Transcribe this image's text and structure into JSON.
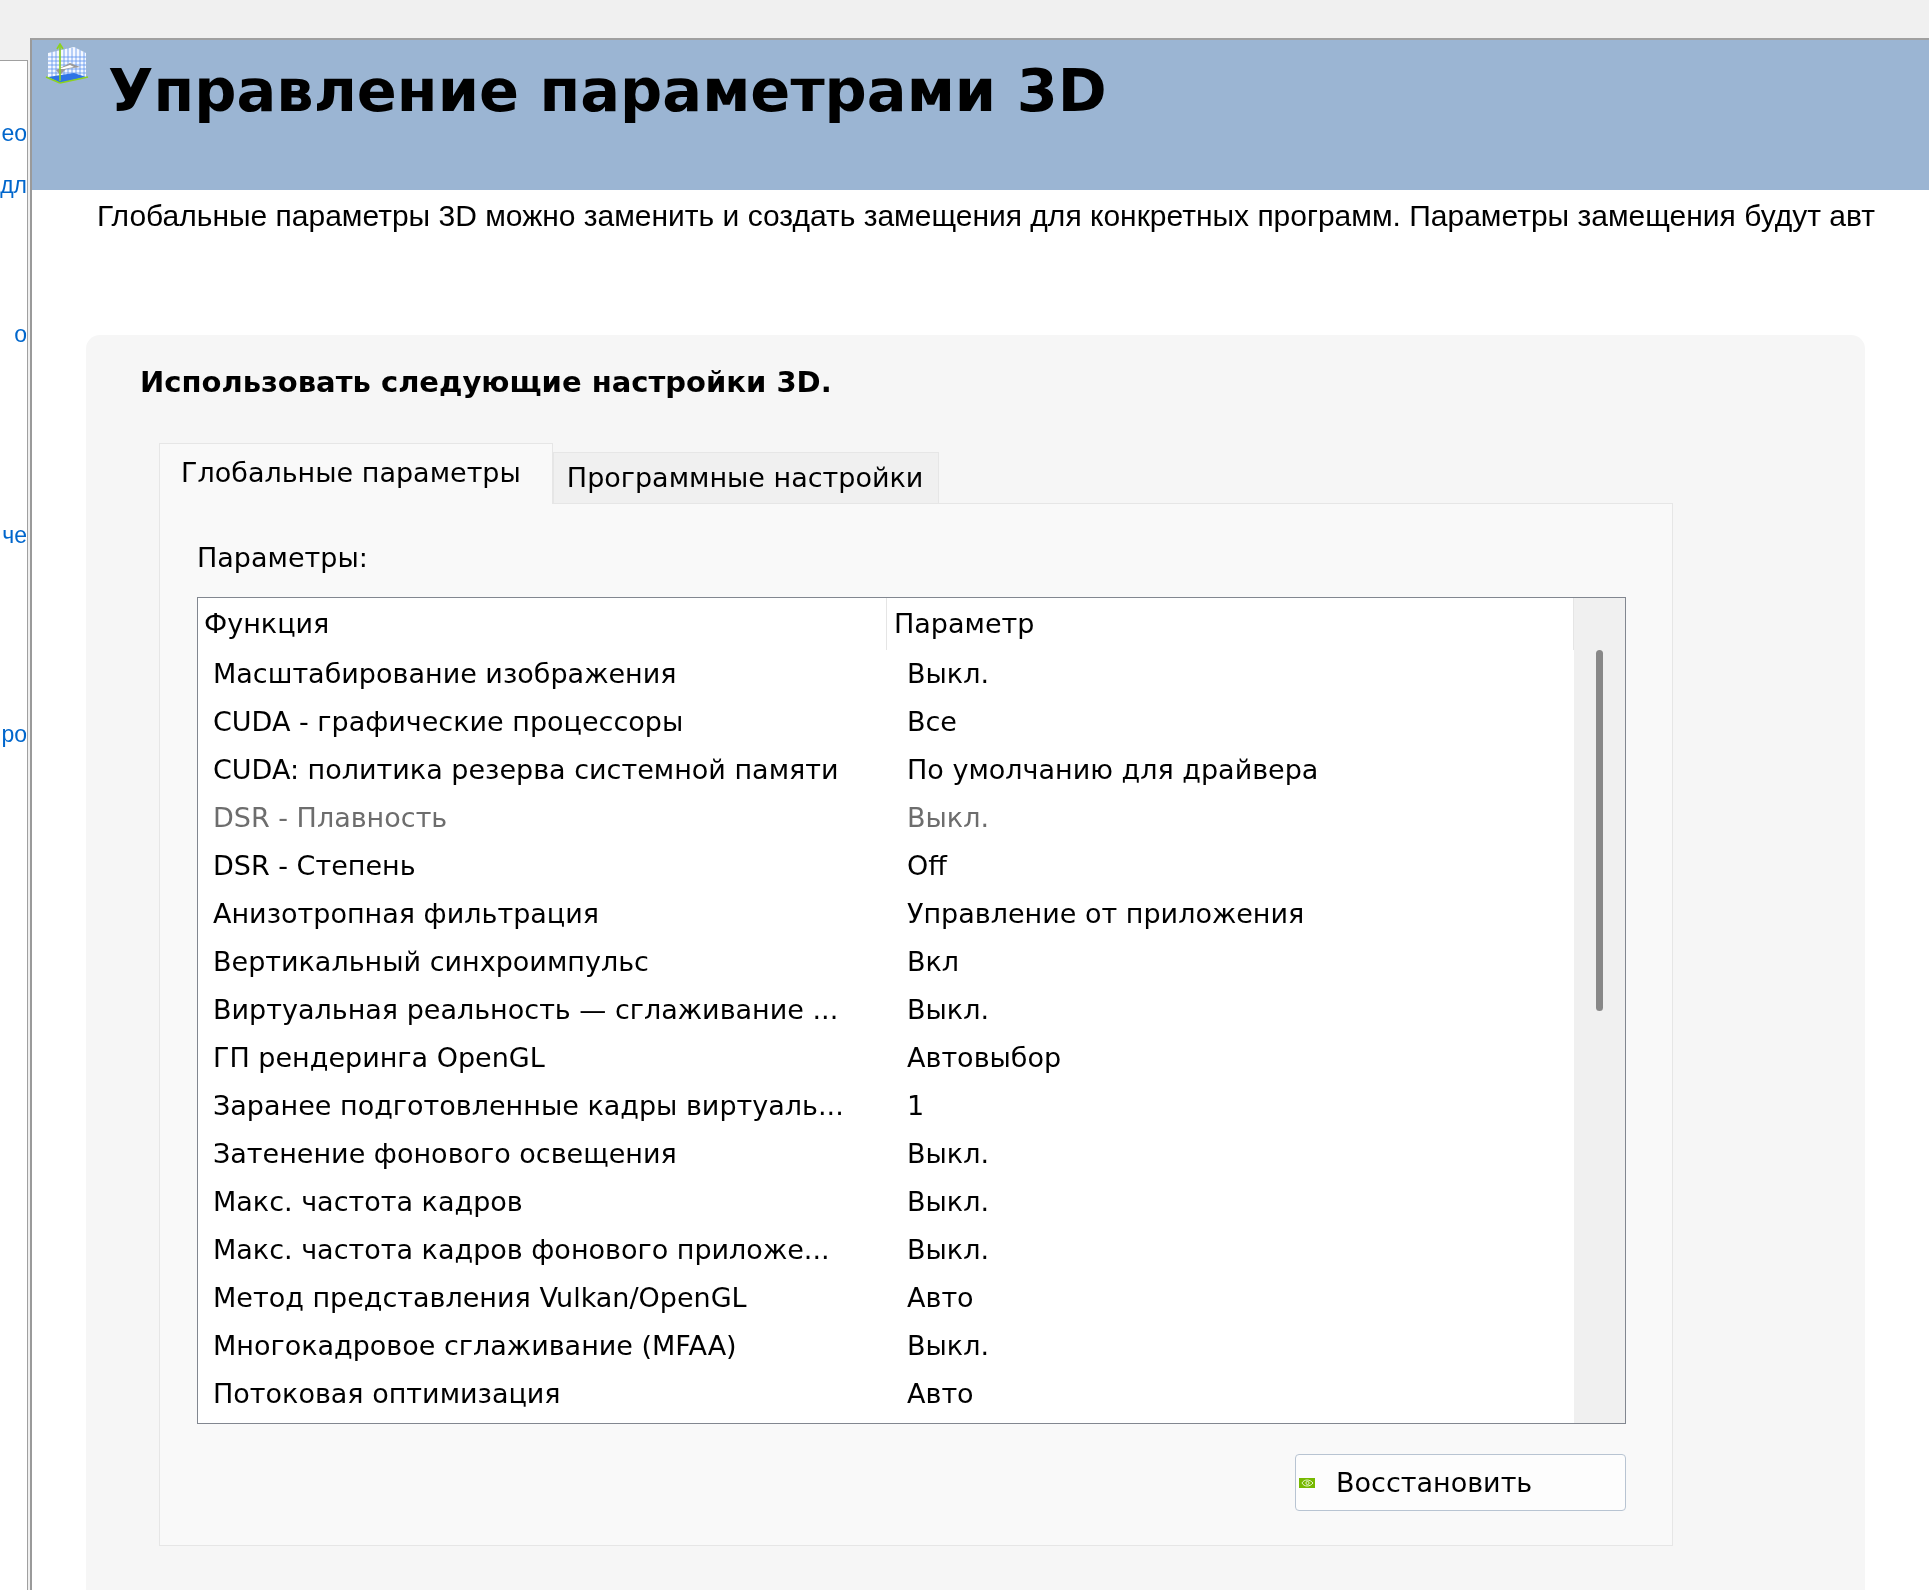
{
  "sidebar": {
    "links": [
      "ео",
      "дл",
      "о",
      "че",
      "ро"
    ]
  },
  "header": {
    "title": "Управление параметрами 3D"
  },
  "description": "Глобальные параметры 3D можно заменить и создать замещения для конкретных программ. Параметры замещения будут авт",
  "panel": {
    "heading": "Использовать следующие настройки 3D.",
    "tabs": [
      {
        "label": "Глобальные параметры",
        "selected": true
      },
      {
        "label": "Программные настройки",
        "selected": false
      }
    ],
    "settings_label": "Параметры:",
    "table": {
      "columns": [
        "Функция",
        "Параметр"
      ],
      "rows": [
        {
          "function": "Масштабирование изображения",
          "value": "Выкл.",
          "disabled": false
        },
        {
          "function": "CUDA - графические процессоры",
          "value": "Все",
          "disabled": false
        },
        {
          "function": "CUDA: политика резерва системной памяти",
          "value": "По умолчанию для драйвера",
          "disabled": false
        },
        {
          "function": "DSR - Плавность",
          "value": "Выкл.",
          "disabled": true
        },
        {
          "function": "DSR - Степень",
          "value": "Off",
          "disabled": false
        },
        {
          "function": "Анизотропная фильтрация",
          "value": "Управление от приложения",
          "disabled": false
        },
        {
          "function": "Вертикальный синхроимпульс",
          "value": "Вкл",
          "disabled": false
        },
        {
          "function": "Виртуальная реальность — сглаживание ...",
          "value": "Выкл.",
          "disabled": false
        },
        {
          "function": "ГП рендеринга OpenGL",
          "value": "Автовыбор",
          "disabled": false
        },
        {
          "function": "Заранее подготовленные кадры виртуаль...",
          "value": "1",
          "disabled": false
        },
        {
          "function": "Затенение фонового освещения",
          "value": "Выкл.",
          "disabled": false
        },
        {
          "function": "Макс. частота кадров",
          "value": "Выкл.",
          "disabled": false
        },
        {
          "function": "Макс. частота кадров фонового приложе...",
          "value": "Выкл.",
          "disabled": false
        },
        {
          "function": "Метод представления Vulkan/OpenGL",
          "value": "Авто",
          "disabled": false
        },
        {
          "function": "Многокадровое сглаживание (MFAA)",
          "value": "Выкл.",
          "disabled": false
        },
        {
          "function": "Потоковая оптимизация",
          "value": "Авто",
          "disabled": false
        }
      ]
    },
    "restore_button": "Восстановить"
  }
}
